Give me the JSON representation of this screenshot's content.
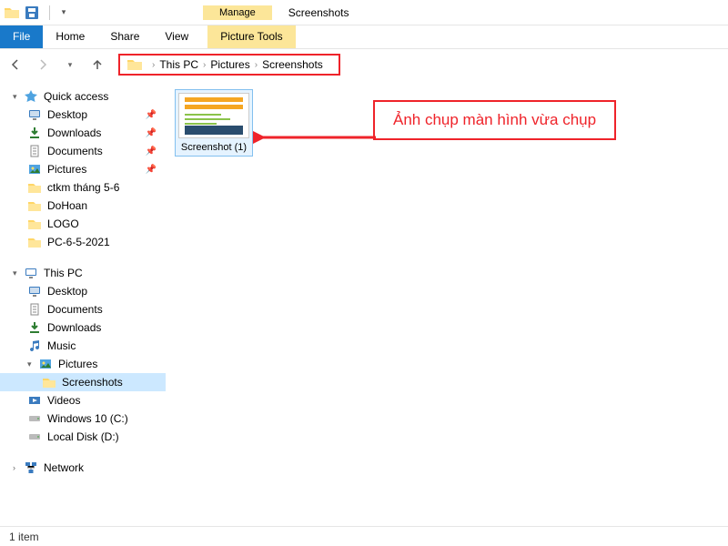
{
  "titlebar": {
    "contextual_label": "Manage",
    "window_title": "Screenshots"
  },
  "ribbon": {
    "file": "File",
    "home": "Home",
    "share": "Share",
    "view": "View",
    "picture_tools": "Picture Tools"
  },
  "breadcrumb": {
    "items": [
      "This PC",
      "Pictures",
      "Screenshots"
    ]
  },
  "sidebar": {
    "quick_access": "Quick access",
    "qa_items": [
      {
        "label": "Desktop",
        "icon": "desktop",
        "pinned": true
      },
      {
        "label": "Downloads",
        "icon": "downloads",
        "pinned": true
      },
      {
        "label": "Documents",
        "icon": "documents",
        "pinned": true
      },
      {
        "label": "Pictures",
        "icon": "pictures",
        "pinned": true
      },
      {
        "label": "ctkm tháng 5-6",
        "icon": "folder",
        "pinned": false
      },
      {
        "label": "DoHoan",
        "icon": "folder",
        "pinned": false
      },
      {
        "label": "LOGO",
        "icon": "folder",
        "pinned": false
      },
      {
        "label": "PC-6-5-2021",
        "icon": "folder",
        "pinned": false
      }
    ],
    "this_pc": "This PC",
    "pc_items": [
      {
        "label": "Desktop",
        "icon": "desktop"
      },
      {
        "label": "Documents",
        "icon": "documents"
      },
      {
        "label": "Downloads",
        "icon": "downloads"
      },
      {
        "label": "Music",
        "icon": "music"
      },
      {
        "label": "Pictures",
        "icon": "pictures",
        "expanded": true
      },
      {
        "label": "Screenshots",
        "icon": "folder",
        "sub": true,
        "selected": true
      },
      {
        "label": "Videos",
        "icon": "videos"
      },
      {
        "label": "Windows 10 (C:)",
        "icon": "drive"
      },
      {
        "label": "Local Disk (D:)",
        "icon": "drive"
      }
    ],
    "network": "Network"
  },
  "content": {
    "file_name": "Screenshot (1)"
  },
  "annotation": {
    "text": "Ảnh chụp màn hình vừa chụp"
  },
  "status": {
    "text": "1 item"
  }
}
